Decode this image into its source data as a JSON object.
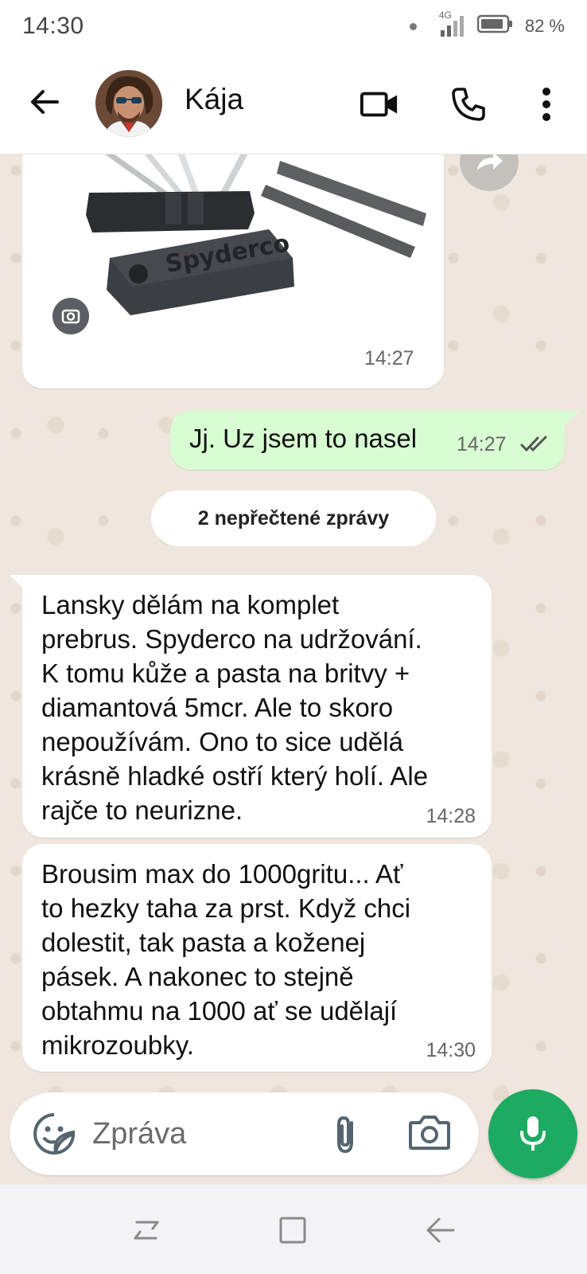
{
  "status_bar": {
    "time": "14:30",
    "network": "4G",
    "battery": "82 %",
    "icons": [
      "notification-dot-icon",
      "signal-icon",
      "battery-icon"
    ]
  },
  "header": {
    "contact_name": "Kája",
    "icons": [
      "back-arrow-icon",
      "video-call-icon",
      "phone-call-icon",
      "more-options-icon"
    ]
  },
  "messages": [
    {
      "type": "image",
      "direction": "incoming",
      "image_brand_text": "Spyderco",
      "time": "14:27"
    },
    {
      "type": "text",
      "direction": "outgoing",
      "text": "Jj. Uz jsem to nasel",
      "time": "14:27",
      "status": "read"
    },
    {
      "type": "text",
      "direction": "incoming",
      "text": "Lansky dělám na komplet\nprebrus. Spyderco na udržování.\nK tomu kůže a pasta na britvy +\ndiamantová 5mcr.  Ale to skoro\nnepoužívám. Ono to sice udělá\nkrásně hladké ostří který holí. Ale\nrajče to neurizne.",
      "time": "14:28"
    },
    {
      "type": "text",
      "direction": "incoming",
      "text": "Brousim max do 1000gritu... Ať\nto hezky taha za prst. Když chci\ndolestit, tak pasta a koženej\npásek. A nakonec to stejně\nobtahmu na 1000 ať se udělají\nmikrozoubky.",
      "time": "14:30"
    }
  ],
  "unread_divider": "2 nepřečtené zprávy",
  "composer": {
    "placeholder": "Zpráva",
    "value": ""
  },
  "colors": {
    "chat_background": "#efe7dd",
    "outgoing_bubble": "#d9fdd3",
    "incoming_bubble": "#ffffff",
    "accent_green": "#1daa61",
    "read_ticks": "#53bdeb"
  }
}
